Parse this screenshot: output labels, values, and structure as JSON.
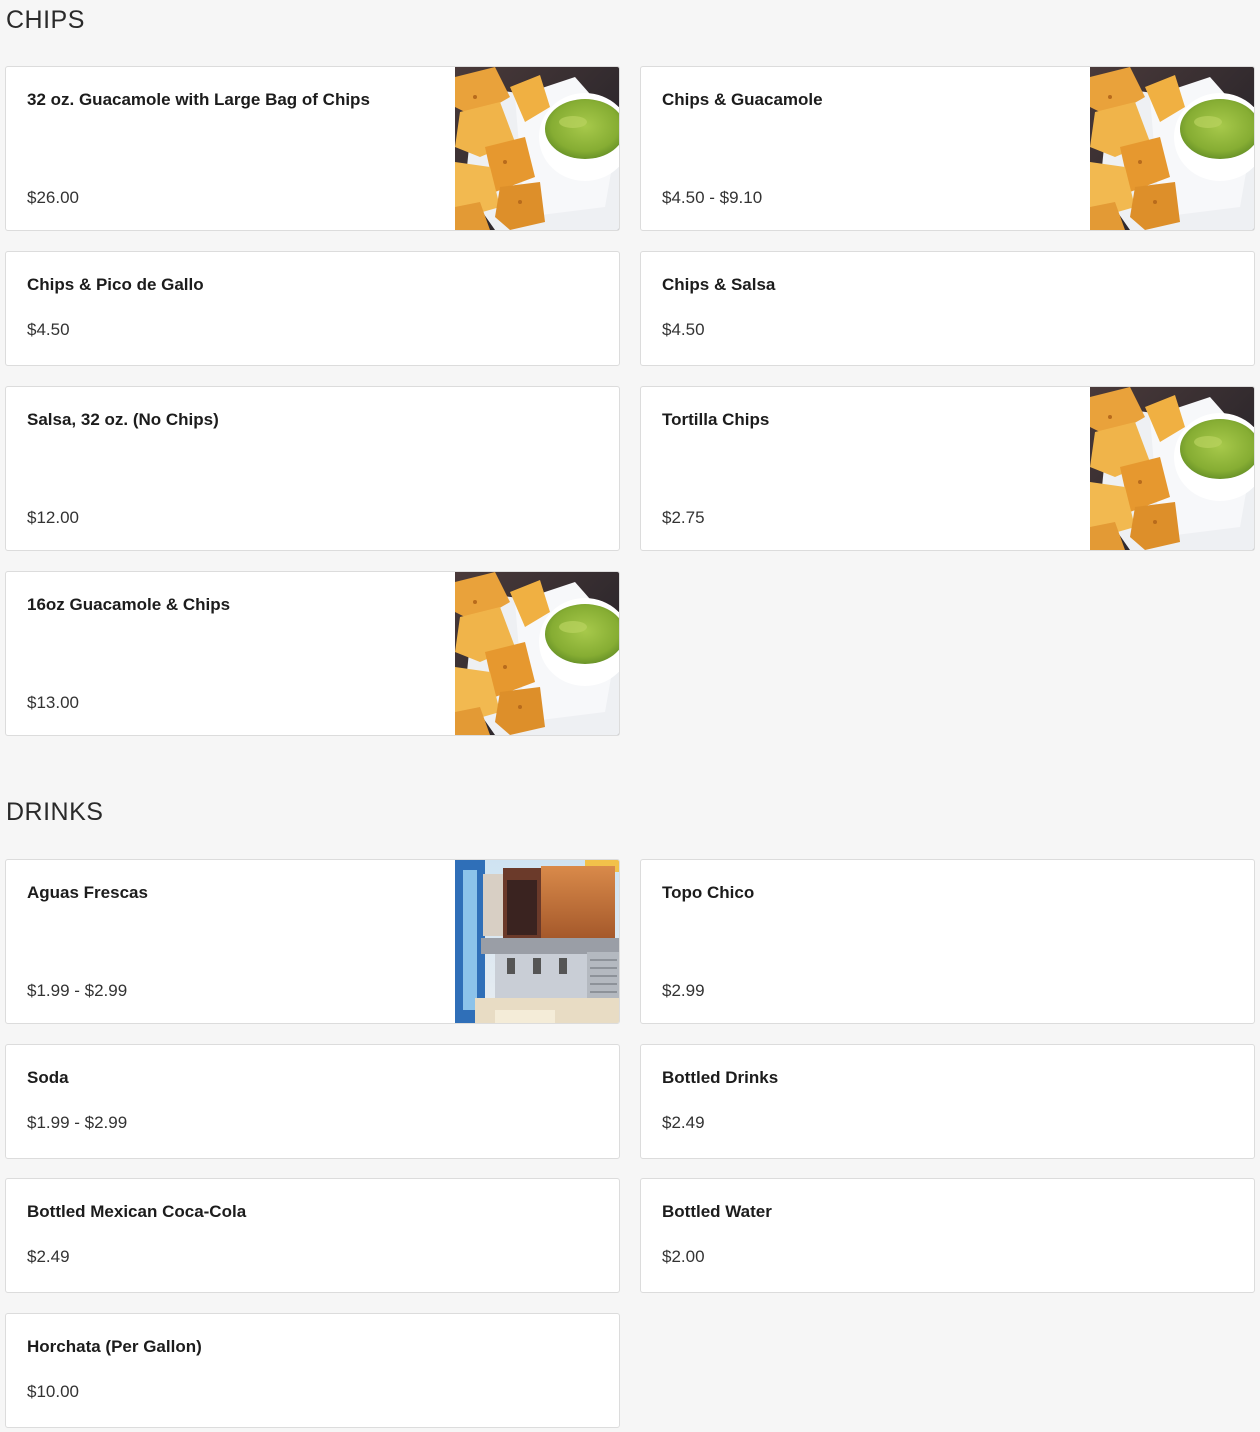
{
  "sections": {
    "chips": {
      "title": "CHIPS",
      "items": [
        {
          "name": "32 oz. Guacamole with Large Bag of Chips",
          "price": "$26.00",
          "image": "chips-guacamole-photo"
        },
        {
          "name": "Chips & Guacamole",
          "price": "$4.50 - $9.10",
          "image": "chips-guacamole-photo"
        },
        {
          "name": "Chips & Pico de Gallo",
          "price": "$4.50"
        },
        {
          "name": "Chips & Salsa",
          "price": "$4.50"
        },
        {
          "name": "Salsa, 32 oz. (No Chips)",
          "price": "$12.00"
        },
        {
          "name": "Tortilla Chips",
          "price": "$2.75",
          "image": "chips-guacamole-photo"
        },
        {
          "name": "16oz Guacamole & Chips",
          "price": "$13.00",
          "image": "chips-guacamole-photo"
        }
      ]
    },
    "drinks": {
      "title": "DRINKS",
      "items": [
        {
          "name": "Aguas Frescas",
          "price": "$1.99 - $2.99",
          "image": "drink-dispenser-photo"
        },
        {
          "name": "Topo Chico",
          "price": "$2.99"
        },
        {
          "name": "Soda",
          "price": "$1.99 - $2.99"
        },
        {
          "name": "Bottled Drinks",
          "price": "$2.49"
        },
        {
          "name": "Bottled Mexican Coca-Cola",
          "price": "$2.49"
        },
        {
          "name": "Bottled Water",
          "price": "$2.00"
        },
        {
          "name": "Horchata (Per Gallon)",
          "price": "$10.00"
        }
      ]
    }
  },
  "colors": {
    "page_background": "#f6f6f6",
    "card_background": "#ffffff",
    "card_border": "#dcdcdc",
    "guacamole_green": "#8db33a",
    "chip_orange": "#e8a33a"
  }
}
